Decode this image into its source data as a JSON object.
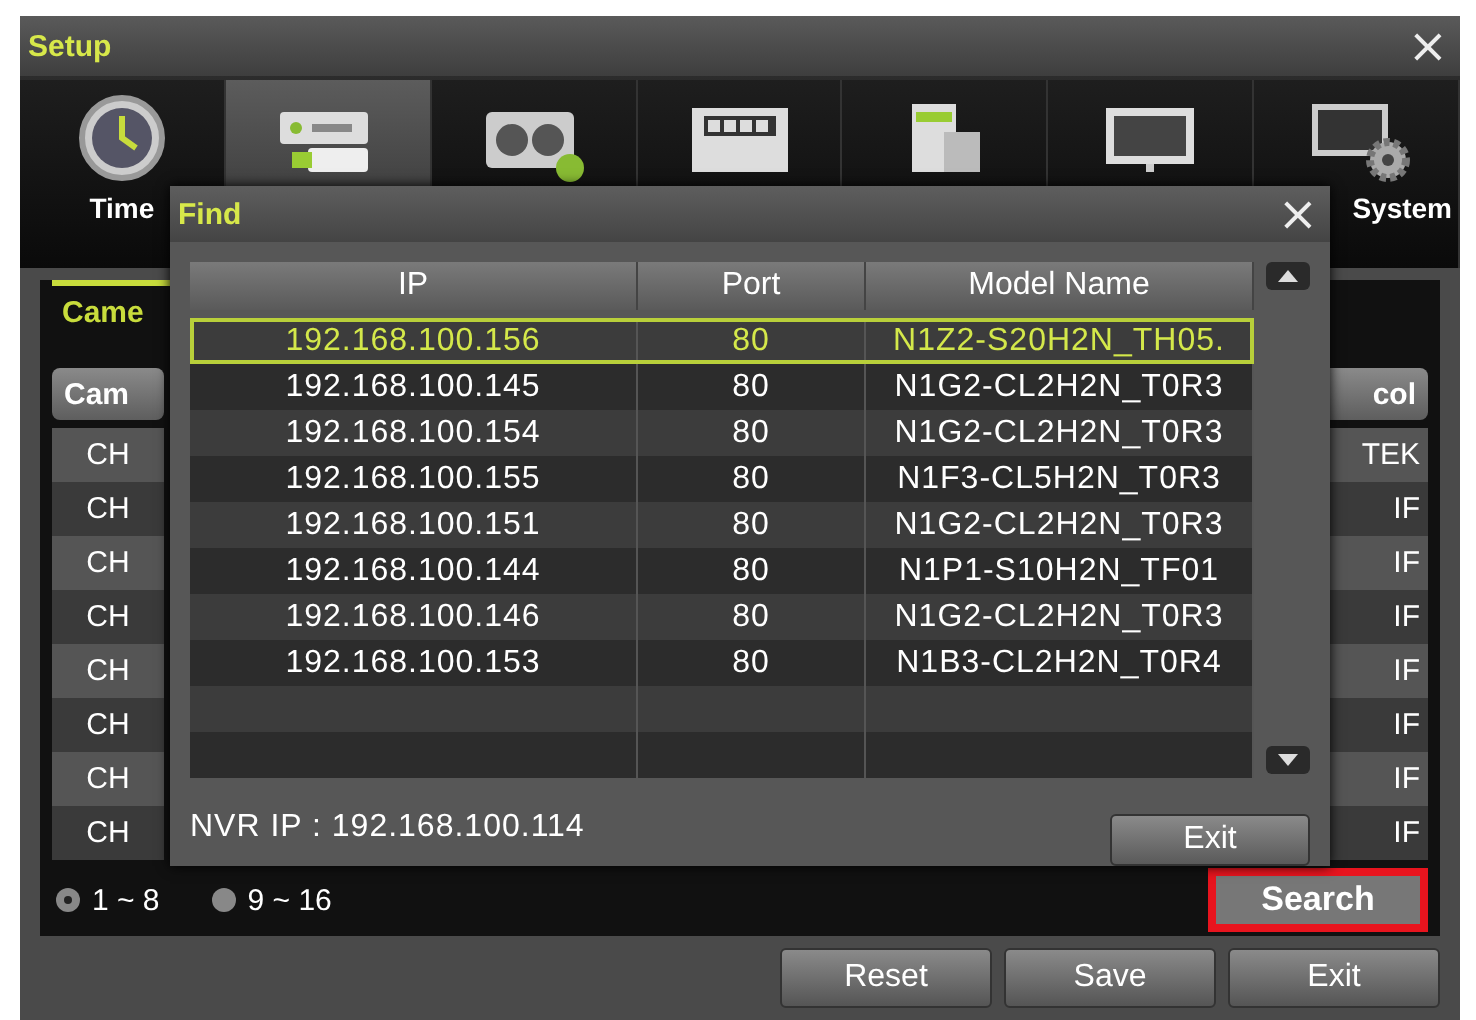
{
  "window": {
    "title": "Setup",
    "close": "×"
  },
  "tabs": [
    {
      "kind": "clock",
      "label": "Time",
      "selected": false
    },
    {
      "kind": "recorder",
      "selected": true
    },
    {
      "kind": "camera",
      "selected": false
    },
    {
      "kind": "disk",
      "selected": false
    },
    {
      "kind": "device",
      "selected": false
    },
    {
      "kind": "monitor",
      "selected": false
    },
    {
      "kind": "system",
      "label": "System",
      "selected": false
    }
  ],
  "subtab": "Came",
  "camera_table": {
    "header_left": "Cam",
    "header_right": "col",
    "rows": [
      {
        "left": "CH",
        "right": "TEK"
      },
      {
        "left": "CH",
        "right": "IF"
      },
      {
        "left": "CH",
        "right": "IF"
      },
      {
        "left": "CH",
        "right": "IF"
      },
      {
        "left": "CH",
        "right": "IF"
      },
      {
        "left": "CH",
        "right": "IF"
      },
      {
        "left": "CH",
        "right": "IF"
      },
      {
        "left": "CH",
        "right": "IF"
      }
    ]
  },
  "pages": [
    {
      "label": "1 ~ 8",
      "selected": true
    },
    {
      "label": "9 ~ 16",
      "selected": false
    }
  ],
  "search_button": {
    "label": "Search",
    "highlighted": true
  },
  "buttons": [
    "Reset",
    "Save",
    "Exit"
  ],
  "find_dialog": {
    "title": "Find",
    "close": "×",
    "columns": [
      "IP",
      "Port",
      "Model Name"
    ],
    "rows": [
      {
        "ip": "192.168.100.156",
        "port": "80",
        "model": "N1Z2-S20H2N_TH05.",
        "selected": true
      },
      {
        "ip": "192.168.100.145",
        "port": "80",
        "model": "N1G2-CL2H2N_T0R3",
        "selected": false
      },
      {
        "ip": "192.168.100.154",
        "port": "80",
        "model": "N1G2-CL2H2N_T0R3",
        "selected": false
      },
      {
        "ip": "192.168.100.155",
        "port": "80",
        "model": "N1F3-CL5H2N_T0R3",
        "selected": false
      },
      {
        "ip": "192.168.100.151",
        "port": "80",
        "model": "N1G2-CL2H2N_T0R3",
        "selected": false
      },
      {
        "ip": "192.168.100.144",
        "port": "80",
        "model": "N1P1-S10H2N_TF01",
        "selected": false
      },
      {
        "ip": "192.168.100.146",
        "port": "80",
        "model": "N1G2-CL2H2N_T0R3",
        "selected": false
      },
      {
        "ip": "192.168.100.153",
        "port": "80",
        "model": "N1B3-CL2H2N_T0R4",
        "selected": false
      }
    ],
    "nvr_ip": "NVR IP : 192.168.100.114",
    "exit": "Exit"
  }
}
